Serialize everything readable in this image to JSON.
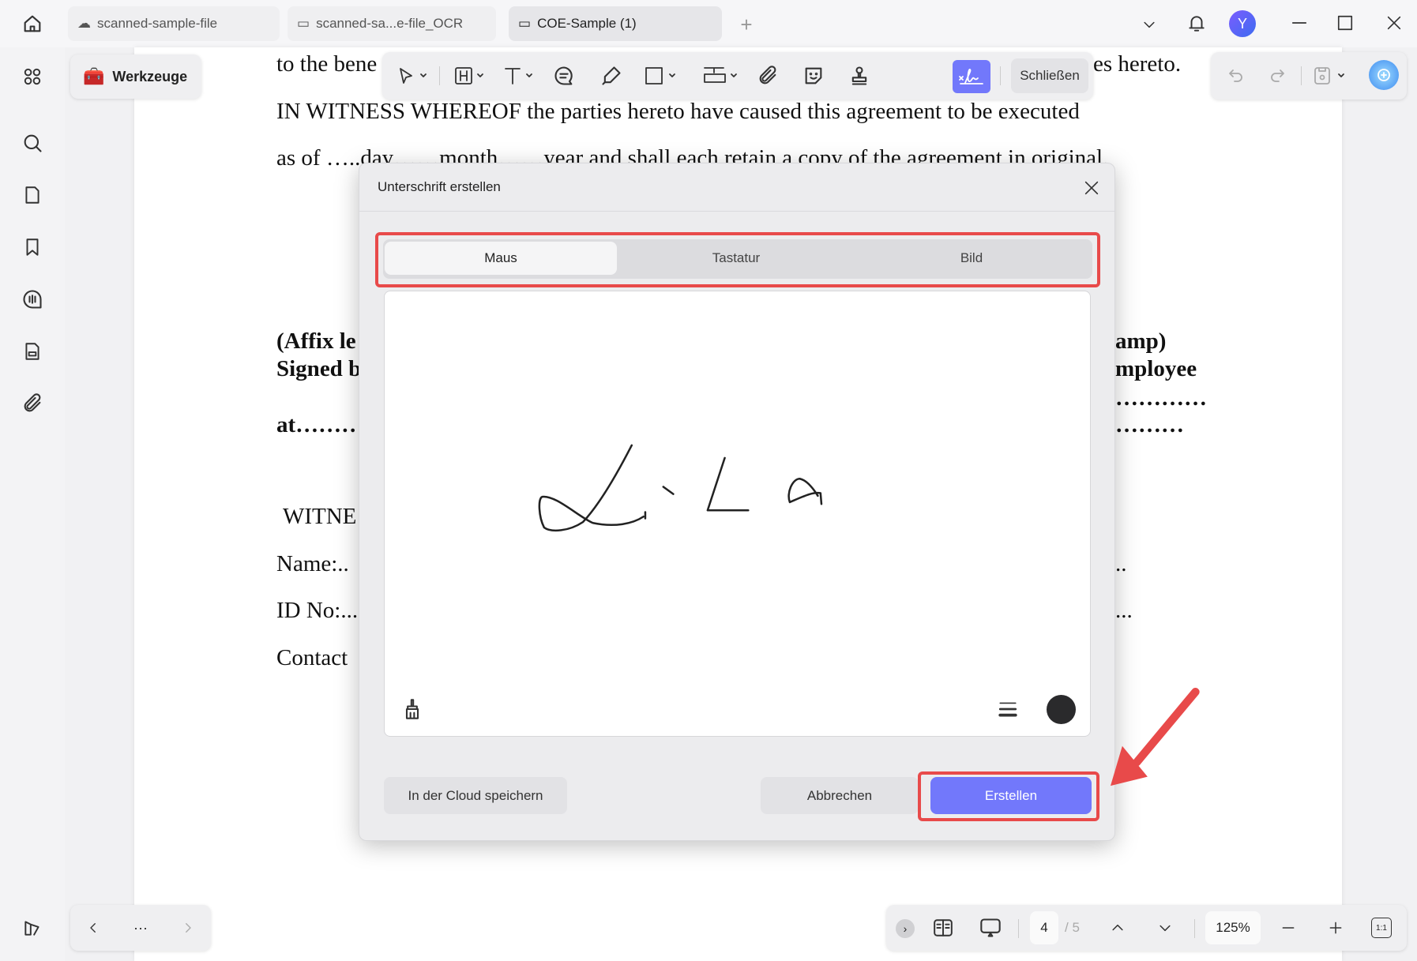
{
  "tabs": [
    {
      "label": "scanned-sample-file",
      "icon": "cloud-icon"
    },
    {
      "label": "scanned-sa...e-file_OCR",
      "icon": "monitor-icon"
    },
    {
      "label": "COE-Sample (1)",
      "icon": "monitor-icon",
      "active": true
    }
  ],
  "titlebar": {
    "avatar_letter": "Y"
  },
  "toolbar": {
    "tools_label": "Werkzeuge",
    "close_label": "Schließen"
  },
  "document": {
    "lines": [
      "to the bene",
      "es hereto.",
      "IN WITNESS WHEREOF the parties hereto have caused this agreement to be executed",
      "as of …..day……month……year and shall each retain a copy of the agreement in original.",
      "(Affix le",
      "amp)",
      "Signed b",
      "mployee",
      "…………",
      "at………",
      "………",
      "WITNE",
      "Name:..",
      "..",
      "ID No:...",
      "...",
      "Contact"
    ]
  },
  "dialog": {
    "title": "Unterschrift erstellen",
    "tabs": [
      "Maus",
      "Tastatur",
      "Bild"
    ],
    "active_tab": "Maus",
    "ink_color": "#222222",
    "cloud_label": "In der Cloud speichern",
    "cancel_label": "Abbrechen",
    "create_label": "Erstellen"
  },
  "pagination": {
    "current": "4",
    "total": "/ 5",
    "zoom": "125%",
    "fit_label": "1:1"
  },
  "colors": {
    "accent": "#7278fb",
    "highlight": "#e84a4a"
  }
}
